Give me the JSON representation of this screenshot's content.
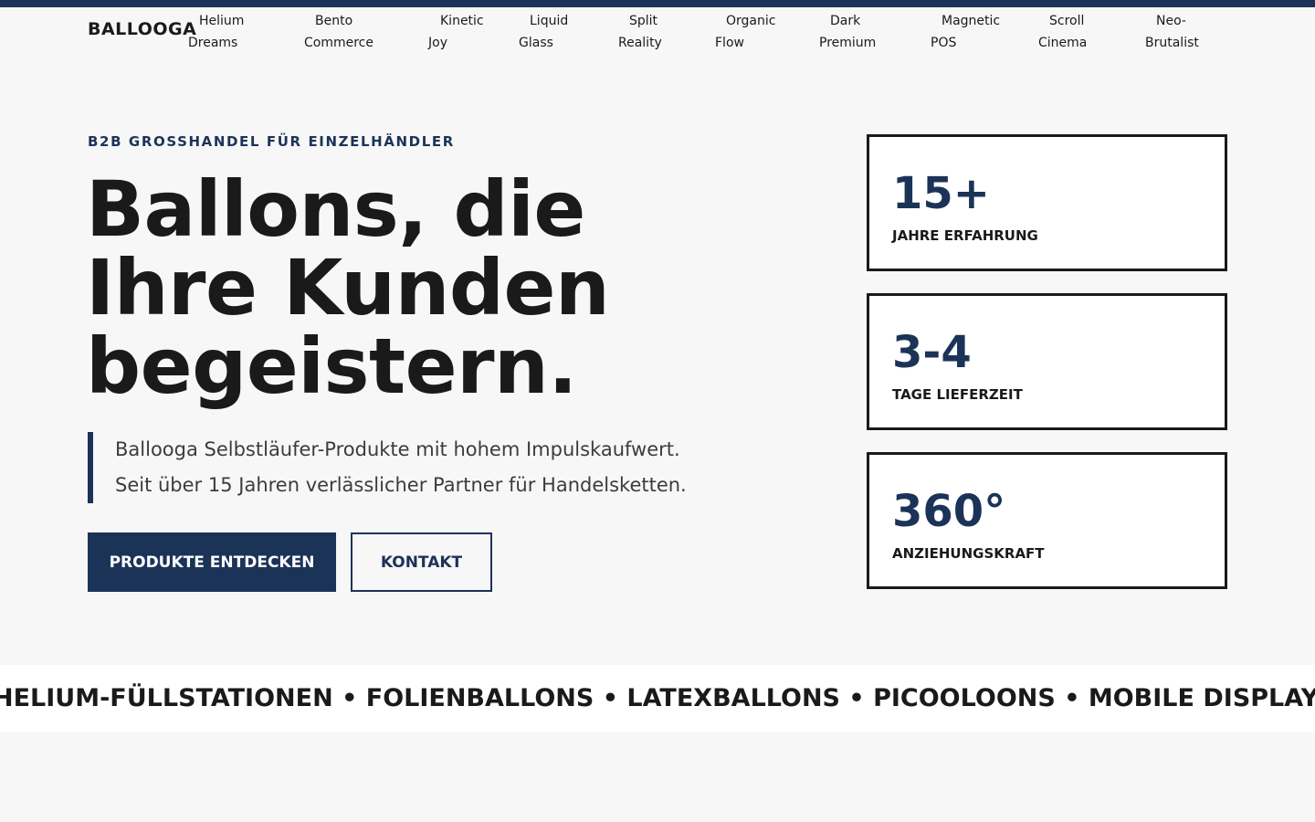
{
  "header": {
    "logo": "BALLOOGA",
    "nav": [
      {
        "line1": "Helium",
        "line2": "Dreams"
      },
      {
        "line1": "Bento",
        "line2": "Commerce"
      },
      {
        "line1": "Kinetic",
        "line2": "Joy"
      },
      {
        "line1": "Liquid",
        "line2": "Glass"
      },
      {
        "line1": "Split",
        "line2": "Reality"
      },
      {
        "line1": "Organic",
        "line2": "Flow"
      },
      {
        "line1": "Dark",
        "line2": "Premium"
      },
      {
        "line1": "Magnetic",
        "line2": "POS"
      },
      {
        "line1": "Scroll",
        "line2": "Cinema"
      },
      {
        "line1": "Neo-",
        "line2": "Brutalist"
      }
    ]
  },
  "hero": {
    "eyebrow": "B2B GROSSHANDEL FÜR EINZELHÄNDLER",
    "headline": [
      "Ballons, die",
      "Ihre Kunden",
      "begeistern."
    ],
    "lead": [
      "Ballooga Selbstläufer-Produkte mit hohem Impulskaufwert.",
      "Seit über 15 Jahren verlässlicher Partner für Handelsketten."
    ],
    "primary_cta": "PRODUKTE ENTDECKEN",
    "secondary_cta": "KONTAKT"
  },
  "stats": [
    {
      "value": "15+",
      "label": "JAHRE ERFAHRUNG"
    },
    {
      "value": "3-4",
      "label": "TAGE LIEFERZEIT"
    },
    {
      "value": "360°",
      "label": "ANZIEHUNGSKRAFT"
    }
  ],
  "marquee": {
    "text": "HELIUM-FÜLLSTATIONEN • FOLIENBALLONS • LATEXBALLONS • PICOOLOONS • MOBILE DISPLAYS • VERKAUFSSTÄNDER"
  },
  "colors": {
    "accent": "#1c3358",
    "background": "#f7f7f7",
    "text": "#1a1a1a"
  }
}
